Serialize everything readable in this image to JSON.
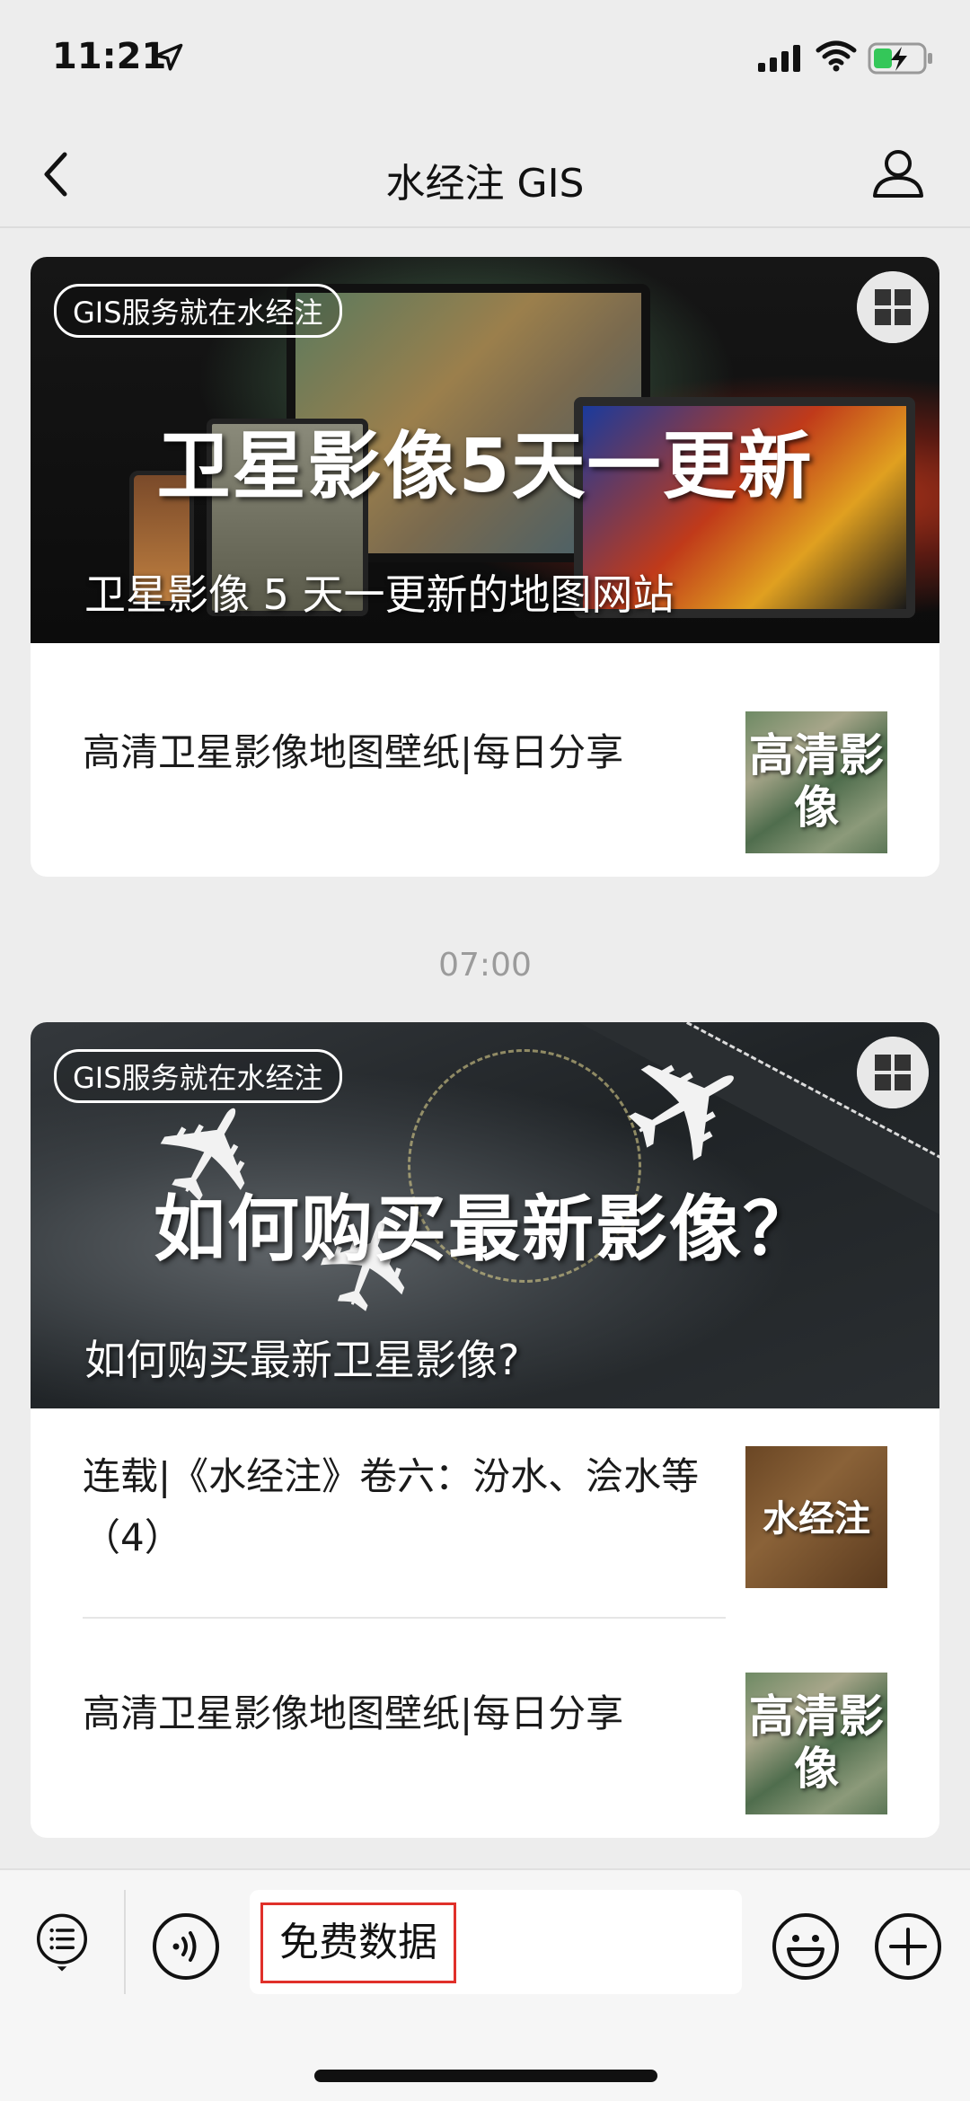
{
  "status_bar": {
    "time": "11:21",
    "icons": [
      "location-arrow-icon",
      "signal-icon",
      "wifi-icon",
      "battery-charging-icon"
    ]
  },
  "nav": {
    "title": "水经注 GIS",
    "back_icon": "chevron-left-icon",
    "profile_icon": "person-icon"
  },
  "cards": [
    {
      "cover": {
        "tag": "GIS服务就在水经注",
        "big_text": "卫星影像5天一更新",
        "caption": "卫星影像 5 天一更新的地图网站"
      },
      "articles": [
        {
          "title": "高清卫星影像地图壁纸|每日分享",
          "thumb_text": "高清影像"
        }
      ]
    },
    {
      "cover": {
        "tag": "GIS服务就在水经注",
        "big_text": "如何购买最新影像？",
        "caption": "如何购买最新卫星影像?"
      },
      "articles": [
        {
          "title": "连载|《水经注》卷六：汾水、浍水等（4）",
          "thumb_text": "水经注"
        },
        {
          "title": "高清卫星影像地图壁纸|每日分享",
          "thumb_text": "高清影像"
        }
      ]
    }
  ],
  "timestamp": "07:00",
  "bottom_bar": {
    "menu_label": "免费数据",
    "icons": [
      "menu-list-icon",
      "voice-icon",
      "emoji-icon",
      "plus-icon"
    ]
  },
  "colors": {
    "background": "#ededed",
    "card": "#ffffff",
    "highlight_border": "#e0302a"
  }
}
